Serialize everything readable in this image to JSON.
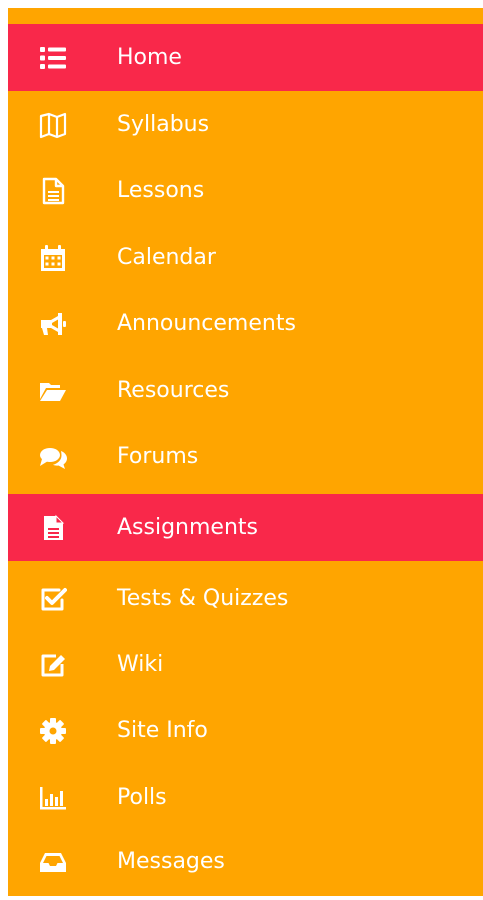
{
  "nav": {
    "colors": {
      "background": "#FFA500",
      "active": "#F9284A",
      "text": "#FFFFFF"
    },
    "items": [
      {
        "label": "Home",
        "icon": "list-icon",
        "active": true
      },
      {
        "label": "Syllabus",
        "icon": "map-icon",
        "active": false
      },
      {
        "label": "Lessons",
        "icon": "file-text-icon",
        "active": false
      },
      {
        "label": "Calendar",
        "icon": "calendar-icon",
        "active": false
      },
      {
        "label": "Announcements",
        "icon": "megaphone-icon",
        "active": false
      },
      {
        "label": "Resources",
        "icon": "folder-open-icon",
        "active": false
      },
      {
        "label": "Forums",
        "icon": "comments-icon",
        "active": false
      },
      {
        "label": "Assignments",
        "icon": "file-icon",
        "active": true
      },
      {
        "label": "Tests & Quizzes",
        "icon": "check-square-icon",
        "active": false
      },
      {
        "label": "Wiki",
        "icon": "edit-icon",
        "active": false
      },
      {
        "label": "Site Info",
        "icon": "gear-icon",
        "active": false
      },
      {
        "label": "Polls",
        "icon": "bar-chart-icon",
        "active": false
      },
      {
        "label": "Messages",
        "icon": "inbox-icon",
        "active": false
      }
    ]
  }
}
